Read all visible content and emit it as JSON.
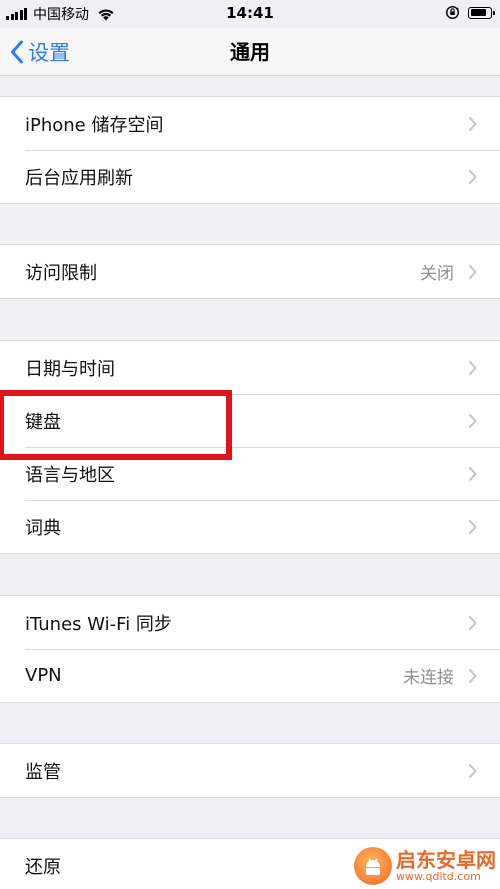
{
  "status_bar": {
    "carrier": "中国移动",
    "time": "14:41",
    "battery_level": 0.85
  },
  "nav": {
    "back_label": "设置",
    "title": "通用"
  },
  "groups": [
    {
      "items": [
        {
          "label": "iPhone 储存空间",
          "detail": ""
        },
        {
          "label": "后台应用刷新",
          "detail": ""
        }
      ]
    },
    {
      "items": [
        {
          "label": "访问限制",
          "detail": "关闭"
        }
      ]
    },
    {
      "items": [
        {
          "label": "日期与时间",
          "detail": ""
        },
        {
          "label": "键盘",
          "detail": ""
        },
        {
          "label": "语言与地区",
          "detail": ""
        },
        {
          "label": "词典",
          "detail": ""
        }
      ]
    },
    {
      "items": [
        {
          "label": "iTunes Wi-Fi 同步",
          "detail": ""
        },
        {
          "label": "VPN",
          "detail": "未连接"
        }
      ]
    },
    {
      "items": [
        {
          "label": "监管",
          "detail": ""
        }
      ]
    },
    {
      "items": [
        {
          "label": "还原",
          "detail": ""
        }
      ]
    }
  ],
  "annotation": {
    "highlight_color": "#e0121b"
  },
  "colors": {
    "accent": "#2f7cf6",
    "background": "#efeff4"
  },
  "watermark": {
    "name": "启东安卓网",
    "url": "www.qdltd.com"
  }
}
